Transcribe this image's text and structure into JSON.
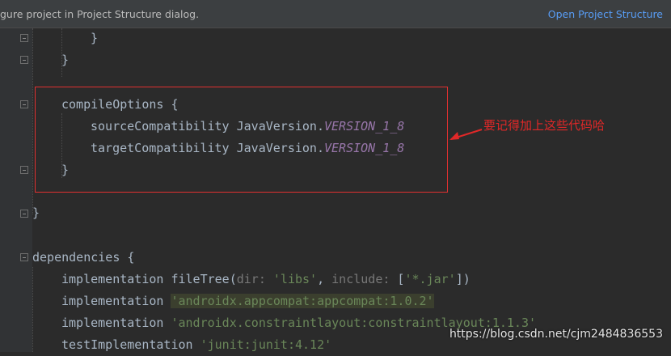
{
  "banner": {
    "message": "gure project in Project Structure dialog.",
    "link": "Open Project Structure"
  },
  "code": {
    "l1": "}",
    "l2": "}",
    "l3": "compileOptions {",
    "l4_a": "sourceCompatibility JavaVersion.",
    "l4_b": "VERSION_1_8",
    "l5_a": "targetCompatibility JavaVersion.",
    "l5_b": "VERSION_1_8",
    "l6": "}",
    "l7": "}",
    "l8": "dependencies {",
    "l9_a": "implementation fileTree(",
    "l9_b": "dir:",
    "l9_c": " 'libs'",
    "l9_d": ", ",
    "l9_e": "include:",
    "l9_f": " [",
    "l9_g": "'*.jar'",
    "l9_h": "])",
    "l10_a": "implementation ",
    "l10_b": "'androidx.appcompat:appcompat:1.0.2'",
    "l11_a": "implementation ",
    "l11_b": "'androidx.constraintlayout:constraintlayout:1.1.3'",
    "l12_a": "testImplementation ",
    "l12_b": "'junit:junit:4.12'"
  },
  "annotation": "要记得加上这些代码哈",
  "watermark": "https://blog.csdn.net/cjm2484836553",
  "colors": {
    "background": "#2b2b2b",
    "annotation_red": "#e02828",
    "link_blue": "#589df6",
    "constant_purple": "#9876aa",
    "string_green": "#6a8759"
  }
}
